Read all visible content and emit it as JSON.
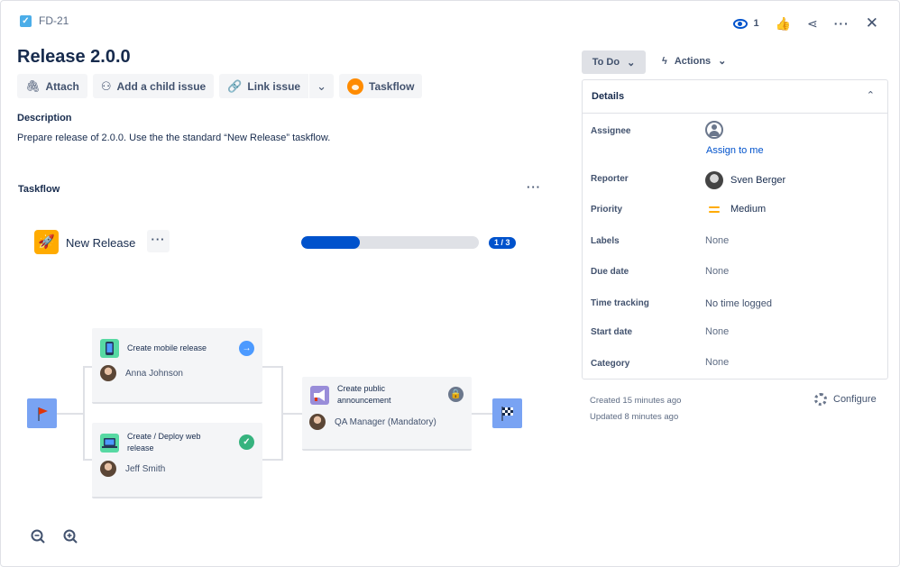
{
  "issue": {
    "key": "FD-21",
    "title": "Release 2.0.0",
    "description_label": "Description",
    "description": "Prepare release of 2.0.0. Use the the standard “New Release” taskflow."
  },
  "toolbar": {
    "attach": "Attach",
    "add_child": "Add a child issue",
    "link_issue": "Link issue",
    "taskflow": "Taskflow"
  },
  "header": {
    "watchers": "1"
  },
  "taskflow": {
    "heading": "Taskflow",
    "name": "New Release",
    "progress": 0.33,
    "progress_label": "1 / 3",
    "nodes": [
      {
        "title": "Create mobile release",
        "assignee": "Anna Johnson",
        "state": "in-progress"
      },
      {
        "title": "Create / Deploy web release",
        "assignee": "Jeff Smith",
        "state": "done"
      },
      {
        "title": "Create public announcement",
        "assignee": "QA Manager (Mandatory)",
        "state": "locked"
      }
    ]
  },
  "status": {
    "label": "To Do",
    "actions_label": "Actions"
  },
  "details": {
    "heading": "Details",
    "assignee_label": "Assignee",
    "assign_to_me": "Assign to me",
    "reporter_label": "Reporter",
    "reporter": "Sven Berger",
    "priority_label": "Priority",
    "priority": "Medium",
    "labels_label": "Labels",
    "labels": "None",
    "due_date_label": "Due date",
    "due_date": "None",
    "time_tracking_label": "Time tracking",
    "time_tracking": "No time logged",
    "start_date_label": "Start date",
    "start_date": "None",
    "category_label": "Category",
    "category": "None"
  },
  "meta": {
    "created": "Created 15 minutes ago",
    "updated": "Updated 8 minutes ago",
    "configure": "Configure"
  },
  "colors": {
    "accent": "#0052cc",
    "done": "#36b37e",
    "in_progress": "#4c9aff",
    "locked": "#6b778c"
  }
}
